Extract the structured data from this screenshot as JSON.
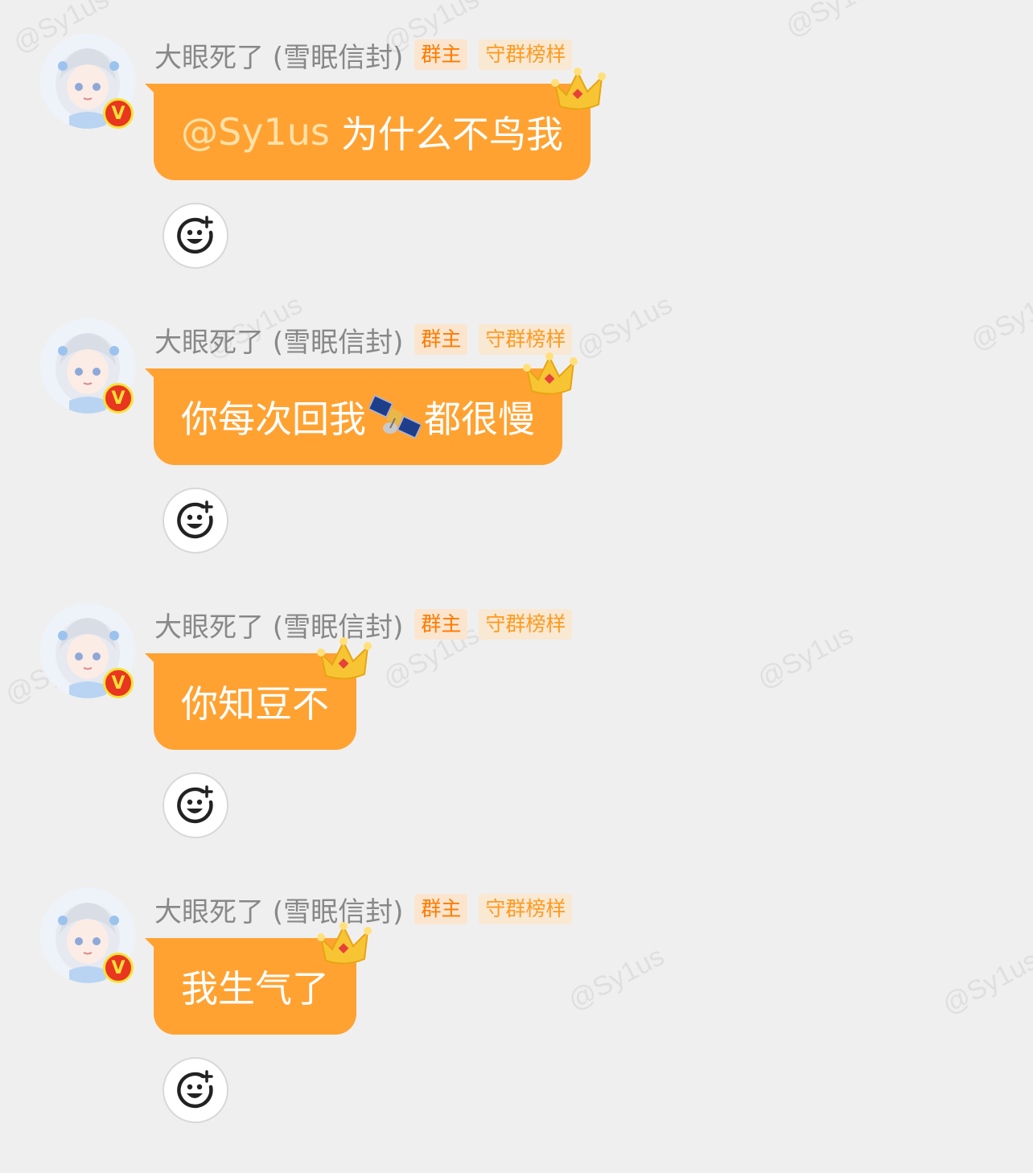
{
  "watermark_text": "@Sy1us",
  "colors": {
    "background": "#f0efef",
    "bubble": "#ffa232",
    "mention": "#ffe1a8",
    "owner_tag_bg": "#fbe5cf",
    "owner_tag_text": "#ff7a00"
  },
  "messages": [
    {
      "sender": "大眼死了 (雪眠信封)",
      "role_tag": "群主",
      "honor_tag": "守群榜样",
      "mention": "@Sy1us",
      "text": "为什么不鸟我",
      "has_crown": true,
      "reaction_icon": "add-reaction-icon"
    },
    {
      "sender": "大眼死了 (雪眠信封)",
      "role_tag": "群主",
      "honor_tag": "守群榜样",
      "text_before": "你每次回我",
      "emoji": "satellite-emoji",
      "text_after": "都很慢",
      "has_crown": true,
      "reaction_icon": "add-reaction-icon"
    },
    {
      "sender": "大眼死了 (雪眠信封)",
      "role_tag": "群主",
      "honor_tag": "守群榜样",
      "text": "你知豆不",
      "has_crown": true,
      "reaction_icon": "add-reaction-icon"
    },
    {
      "sender": "大眼死了 (雪眠信封)",
      "role_tag": "群主",
      "honor_tag": "守群榜样",
      "text": "我生气了",
      "has_crown": true,
      "reaction_icon": "add-reaction-icon"
    }
  ]
}
